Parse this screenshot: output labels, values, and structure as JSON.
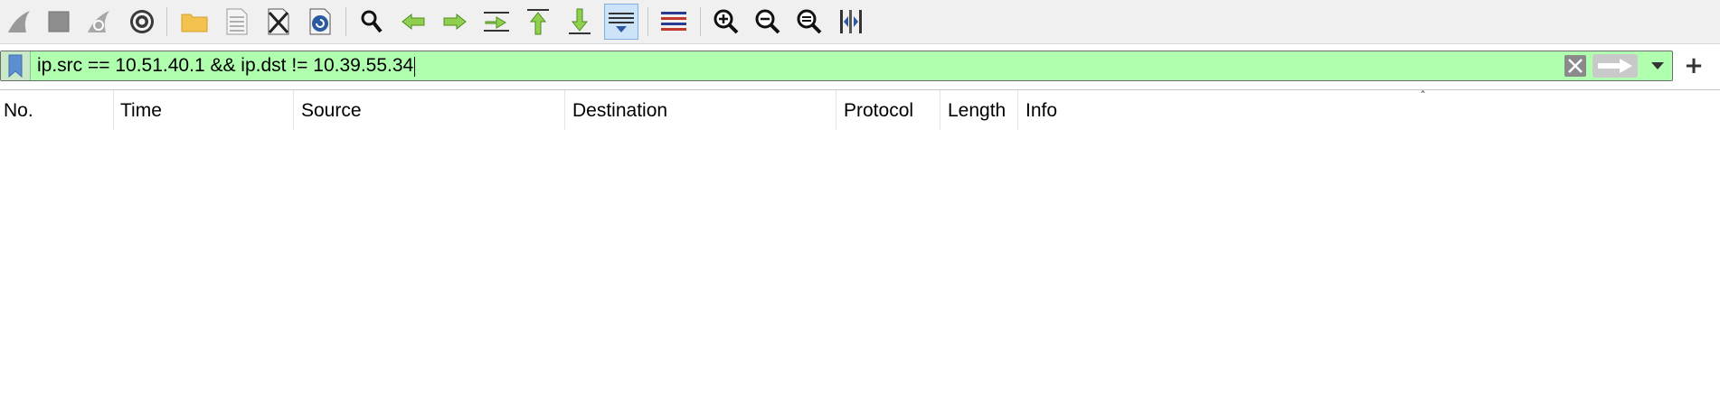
{
  "toolbar": {
    "buttons": [
      {
        "name": "start-capture",
        "icon": "shark-fin-icon"
      },
      {
        "name": "stop-capture",
        "icon": "stop-square-icon"
      },
      {
        "name": "restart-capture",
        "icon": "shark-fin-restart-icon"
      },
      {
        "name": "capture-options",
        "icon": "gear-icon"
      },
      {
        "name": "open-file",
        "icon": "folder-icon"
      },
      {
        "name": "save-file",
        "icon": "binary-file-icon"
      },
      {
        "name": "close-file",
        "icon": "close-file-icon"
      },
      {
        "name": "reload-file",
        "icon": "reload-file-icon"
      },
      {
        "name": "find-packet",
        "icon": "magnifier-icon"
      },
      {
        "name": "go-previous",
        "icon": "arrow-left-icon"
      },
      {
        "name": "go-next",
        "icon": "arrow-right-icon"
      },
      {
        "name": "go-to-packet",
        "icon": "go-to-packet-icon"
      },
      {
        "name": "go-first",
        "icon": "arrow-up-first-icon"
      },
      {
        "name": "go-last",
        "icon": "arrow-down-last-icon"
      },
      {
        "name": "auto-scroll",
        "icon": "auto-scroll-icon",
        "active": true
      },
      {
        "name": "colorize",
        "icon": "colorize-lines-icon"
      },
      {
        "name": "zoom-in",
        "icon": "zoom-in-icon"
      },
      {
        "name": "zoom-out",
        "icon": "zoom-out-icon"
      },
      {
        "name": "normal-size",
        "icon": "zoom-reset-icon"
      },
      {
        "name": "resize-columns",
        "icon": "resize-columns-icon"
      }
    ]
  },
  "filter": {
    "value": "ip.src == 10.51.40.1 && ip.dst != 10.39.55.34",
    "placeholder": "",
    "valid_color": "#afffaf",
    "bookmark_icon": "bookmark-icon",
    "clear_icon": "clear-x-icon",
    "apply_icon": "apply-arrow-icon",
    "dropdown_icon": "chevron-down-icon",
    "add_label": "+"
  },
  "packet_list": {
    "columns": [
      "No.",
      "Time",
      "Source",
      "Destination",
      "Protocol",
      "Length",
      "Info"
    ],
    "rows": []
  },
  "colors": {
    "toolbar_bg": "#f0f0f0",
    "filter_valid": "#afffaf",
    "active_button": "#cde3f7"
  }
}
